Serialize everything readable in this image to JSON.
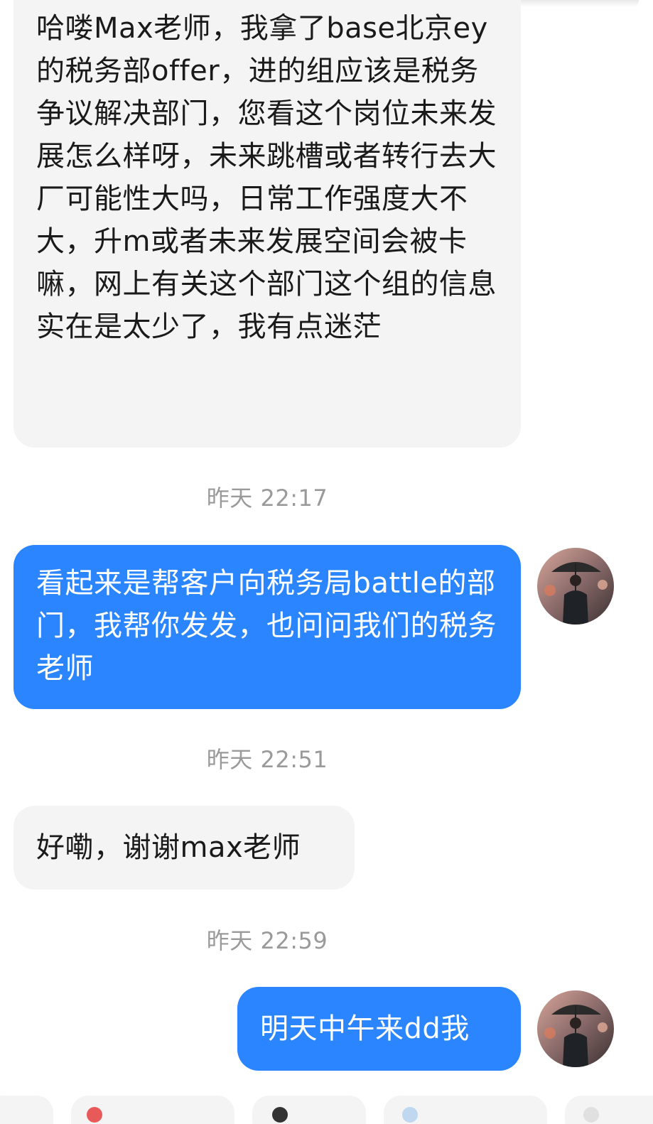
{
  "messages": [
    {
      "direction": "incoming",
      "text": "哈喽Max老师，我拿了base北京ey的税务部offer，进的组应该是税务争议解决部门，您看这个岗位未来发展怎么样呀，未来跳槽或者转行去大厂可能性大吗，日常工作强度大不大，升m或者未来发展空间会被卡嘛，网上有关这个部门这个组的信息实在是太少了，我有点迷茫"
    },
    {
      "direction": "outgoing",
      "text": "看起来是帮客户向税务局battle的部门，我帮你发发，也问问我们的税务老师"
    },
    {
      "direction": "incoming",
      "text": "好嘞，谢谢max老师"
    },
    {
      "direction": "outgoing",
      "text": "明天中午来dd我"
    }
  ],
  "timestamps": [
    "昨天 22:17",
    "昨天 22:51",
    "昨天 22:59"
  ],
  "colors": {
    "outgoing_bubble": "#2a85ff",
    "incoming_bubble": "#f4f4f4",
    "timestamp_text": "#9a9a9a"
  },
  "avatar": {
    "icon": "avatar-man-with-umbrella"
  }
}
